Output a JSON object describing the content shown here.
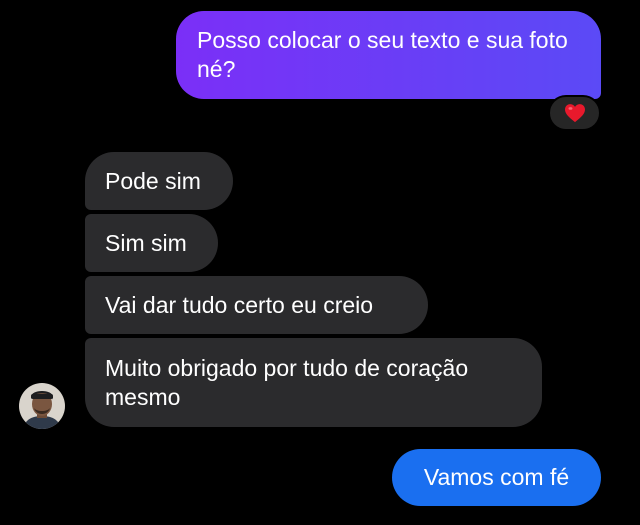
{
  "colors": {
    "background": "#000000",
    "outgoing_top_gradient_start": "#7b2ff7",
    "outgoing_top_gradient_end": "#5b4af6",
    "outgoing_bottom": "#1a6ff0",
    "incoming_bubble": "#2b2b2d",
    "reaction_pill": "#262626",
    "heart": "#e8192c"
  },
  "messages": {
    "outgoing_1": "Posso colocar o seu texto e sua foto né?",
    "incoming_1": "Pode sim",
    "incoming_2": "Sim sim",
    "incoming_3": "Vai dar tudo certo eu creio",
    "incoming_4": "Muito obrigado por tudo de coração mesmo",
    "outgoing_2": "Vamos com fé"
  },
  "reaction": {
    "icon": "red-heart-icon"
  },
  "avatar": {
    "icon": "contact-avatar"
  }
}
